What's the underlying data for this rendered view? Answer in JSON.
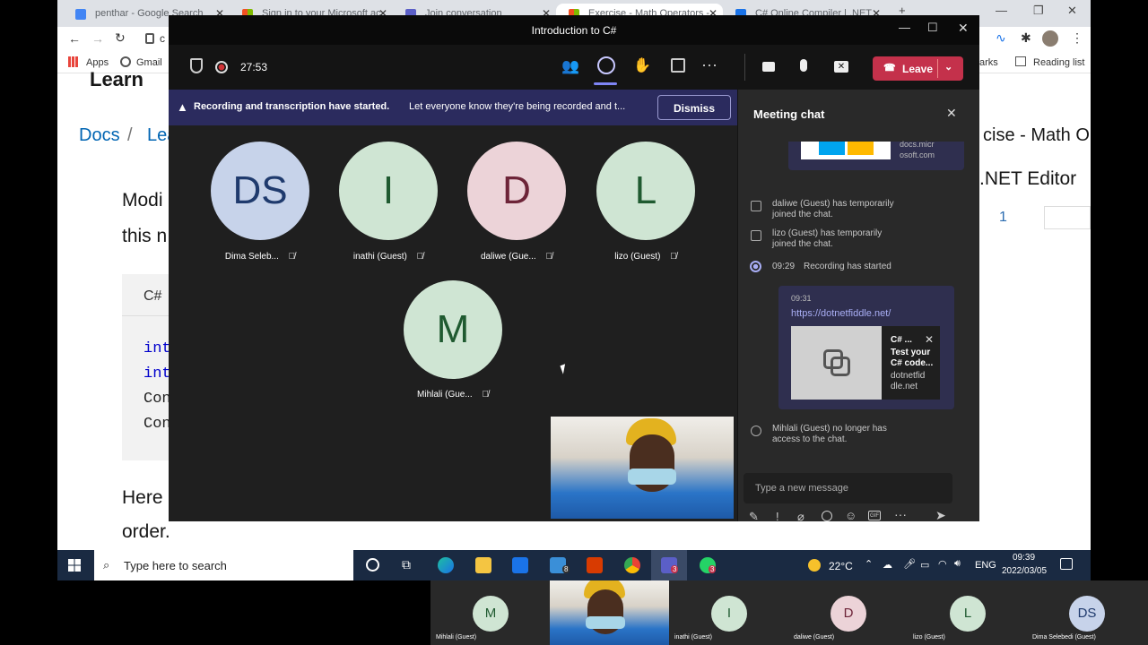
{
  "browser": {
    "tabs": [
      {
        "label": "penthar - Google Search",
        "color": "#4285f4"
      },
      {
        "label": "Sign in to your Microsoft ac",
        "color": "#f25022"
      },
      {
        "label": "Join conversation",
        "color": "#5b5fc7"
      },
      {
        "label": "Exercise - Math Operators -",
        "color": "#f25022"
      },
      {
        "label": "C# Online Compiler | .NET",
        "color": "#1a73e8"
      }
    ],
    "address": "c",
    "bookmarks": {
      "apps": "Apps",
      "gmail": "Gmail",
      "marks": "arks",
      "reading_list": "Reading list"
    }
  },
  "learn_page": {
    "heading": "Learn",
    "breadcrumb_docs": "Docs",
    "breadcrumb_sep": "/",
    "breadcrumb_learn": "Lea",
    "right_title": "cise - Math Op",
    "editor_label": ".NET Editor",
    "editor_line": "1",
    "body_1": "Modi",
    "body_2": "this n",
    "code_lang": "C#",
    "code_lines": [
      "int",
      "int",
      "Con",
      "Con"
    ],
    "body_3": "Here",
    "body_4": "order."
  },
  "teams": {
    "title": "Introduction to C#",
    "timer": "27:53",
    "leave_label": "Leave",
    "banner_bold": "Recording and transcription have started.",
    "banner_text": "Let everyone know they're being recorded and t...",
    "dismiss_label": "Dismiss",
    "participants": [
      {
        "initials": "DS",
        "name": "Dima Seleb...",
        "bg": "#c7d3ea",
        "fg": "#1f3a6d"
      },
      {
        "initials": "I",
        "name": "inathi (Guest)",
        "bg": "#cfe5d3",
        "fg": "#1f5a30"
      },
      {
        "initials": "D",
        "name": "daliwe (Gue...",
        "bg": "#ecd3d8",
        "fg": "#6d2438"
      },
      {
        "initials": "L",
        "name": "lizo (Guest)",
        "bg": "#cfe5d3",
        "fg": "#1f5a30"
      },
      {
        "initials": "M",
        "name": "Mihlali (Gue...",
        "bg": "#cfe5d3",
        "fg": "#1f5a30"
      }
    ],
    "chat": {
      "title": "Meeting chat",
      "preview_domain_1": "docs.micr",
      "preview_domain_2": "osoft.com",
      "events": [
        {
          "l1": "daliwe (Guest) has temporarily",
          "l2": "joined the chat."
        },
        {
          "l1": "lizo (Guest) has temporarily",
          "l2": "joined the chat."
        }
      ],
      "recording_time": "09:29",
      "recording_text": "Recording has started",
      "msg_time": "09:31",
      "msg_link": "https://dotnetfiddle.net/",
      "card_title": "C# ...",
      "card_desc_1": "Test your",
      "card_desc_2": "C# code...",
      "card_domain_1": "dotnetfid",
      "card_domain_2": "dle.net",
      "left_l1": "Mihlali (Guest) no longer has",
      "left_l2": "access to the chat.",
      "compose_placeholder": "Type a new message"
    }
  },
  "taskbar": {
    "search_placeholder": "Type here to search",
    "weather": "22°C",
    "lang": "ENG",
    "time": "09:39",
    "date": "2022/03/05",
    "mail_badge": "8",
    "teams_badge": "3",
    "whatsapp_badge": "3"
  },
  "gallery": [
    {
      "initials": "M",
      "name": "Mihlali (Guest)",
      "bg": "#cfe5d3",
      "fg": "#1f5a30"
    },
    {
      "initials": "",
      "name": "",
      "bg": "#3a6fd8",
      "fg": "#fff"
    },
    {
      "initials": "I",
      "name": "inathi (Guest)",
      "bg": "#cfe5d3",
      "fg": "#1f5a30"
    },
    {
      "initials": "D",
      "name": "daliwe (Guest)",
      "bg": "#ecd3d8",
      "fg": "#6d2438"
    },
    {
      "initials": "L",
      "name": "lizo (Guest)",
      "bg": "#cfe5d3",
      "fg": "#1f5a30"
    },
    {
      "initials": "DS",
      "name": "Dima Selebedi (Guest)",
      "bg": "#c7d3ea",
      "fg": "#1f3a6d"
    }
  ]
}
